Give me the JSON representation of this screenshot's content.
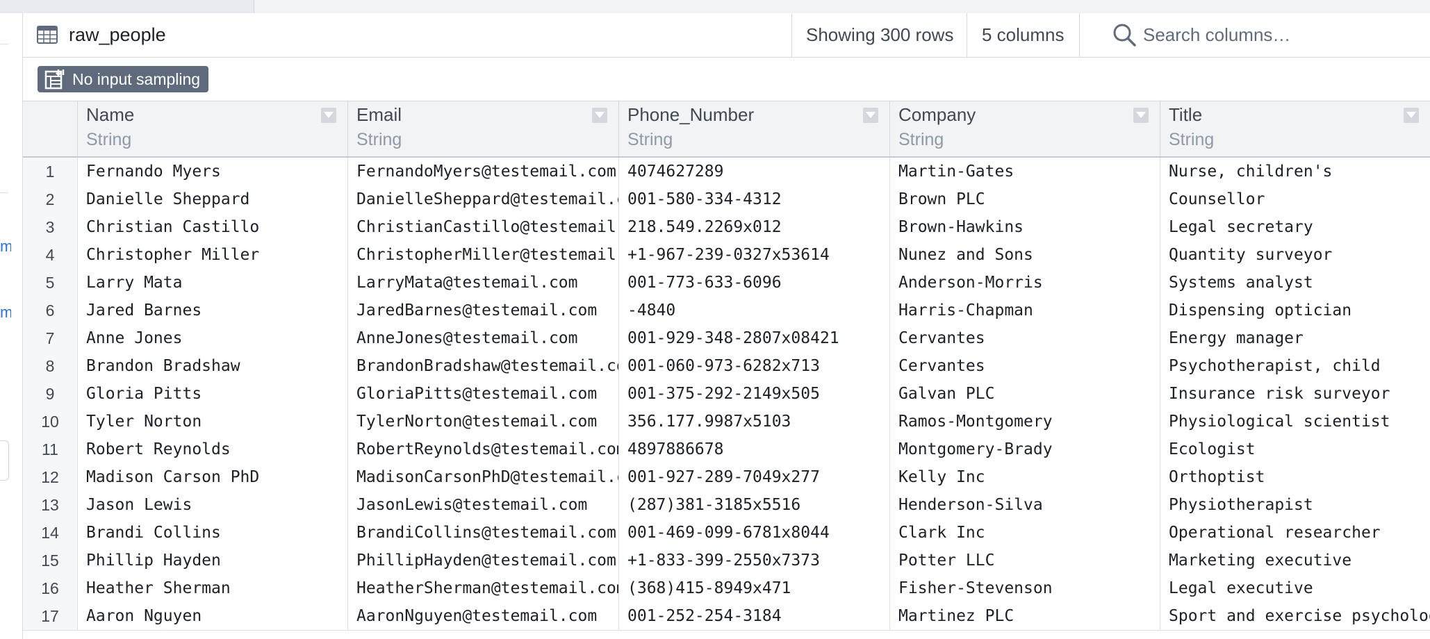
{
  "toolbar": {
    "dataset_name": "raw_people",
    "row_count": "Showing 300 rows",
    "column_count": "5 columns",
    "search_placeholder": "Search columns…"
  },
  "badge": {
    "label": "No input sampling"
  },
  "table": {
    "columns": [
      {
        "name": "Name",
        "type": "String"
      },
      {
        "name": "Email",
        "type": "String"
      },
      {
        "name": "Phone_Number",
        "type": "String"
      },
      {
        "name": "Company",
        "type": "String"
      },
      {
        "name": "Title",
        "type": "String"
      }
    ],
    "rows": [
      {
        "num": "1",
        "cells": [
          "Fernando Myers",
          "FernandoMyers@testemail.com",
          "4074627289",
          "Martin-Gates",
          "Nurse, children's"
        ]
      },
      {
        "num": "2",
        "cells": [
          "Danielle Sheppard",
          "DanielleSheppard@testemail.com",
          "001-580-334-4312",
          "Brown PLC",
          "Counsellor"
        ]
      },
      {
        "num": "3",
        "cells": [
          "Christian Castillo",
          "ChristianCastillo@testemail.com",
          "218.549.2269x012",
          "Brown-Hawkins",
          "Legal secretary"
        ]
      },
      {
        "num": "4",
        "cells": [
          "Christopher Miller",
          "ChristopherMiller@testemail.com",
          "+1-967-239-0327x53614",
          "Nunez and Sons",
          "Quantity surveyor"
        ]
      },
      {
        "num": "5",
        "cells": [
          "Larry Mata",
          "LarryMata@testemail.com",
          "001-773-633-6096",
          "Anderson-Morris",
          "Systems analyst"
        ]
      },
      {
        "num": "6",
        "cells": [
          "Jared Barnes",
          "JaredBarnes@testemail.com",
          "-4840",
          "Harris-Chapman",
          "Dispensing optician"
        ]
      },
      {
        "num": "7",
        "cells": [
          "Anne Jones",
          "AnneJones@testemail.com",
          "001-929-348-2807x08421",
          "Cervantes",
          "Energy manager"
        ]
      },
      {
        "num": "8",
        "cells": [
          "Brandon Bradshaw",
          "BrandonBradshaw@testemail.com",
          "001-060-973-6282x713",
          "Cervantes",
          "Psychotherapist, child"
        ]
      },
      {
        "num": "9",
        "cells": [
          "Gloria Pitts",
          "GloriaPitts@testemail.com",
          "001-375-292-2149x505",
          "Galvan PLC",
          "Insurance risk surveyor"
        ]
      },
      {
        "num": "10",
        "cells": [
          "Tyler Norton",
          "TylerNorton@testemail.com",
          "356.177.9987x5103",
          "Ramos-Montgomery",
          "Physiological scientist"
        ]
      },
      {
        "num": "11",
        "cells": [
          "Robert Reynolds",
          "RobertReynolds@testemail.com",
          "4897886678",
          "Montgomery-Brady",
          "Ecologist"
        ]
      },
      {
        "num": "12",
        "cells": [
          "Madison Carson PhD",
          "MadisonCarsonPhD@testemail.com",
          "001-927-289-7049x277",
          "Kelly Inc",
          "Orthoptist"
        ]
      },
      {
        "num": "13",
        "cells": [
          "Jason Lewis",
          "JasonLewis@testemail.com",
          "(287)381-3185x5516",
          "Henderson-Silva",
          "Physiotherapist"
        ]
      },
      {
        "num": "14",
        "cells": [
          "Brandi Collins",
          "BrandiCollins@testemail.com",
          "001-469-099-6781x8044",
          "Clark Inc",
          "Operational researcher"
        ]
      },
      {
        "num": "15",
        "cells": [
          "Phillip Hayden",
          "PhillipHayden@testemail.com",
          "+1-833-399-2550x7373",
          "Potter LLC",
          "Marketing executive"
        ]
      },
      {
        "num": "16",
        "cells": [
          "Heather Sherman",
          "HeatherSherman@testemail.com",
          "(368)415-8949x471",
          "Fisher-Stevenson",
          "Legal executive"
        ]
      },
      {
        "num": "17",
        "cells": [
          "Aaron Nguyen",
          "AaronNguyen@testemail.com",
          "001-252-254-3184",
          "Martinez PLC",
          "Sport and exercise psychologist"
        ]
      }
    ]
  }
}
